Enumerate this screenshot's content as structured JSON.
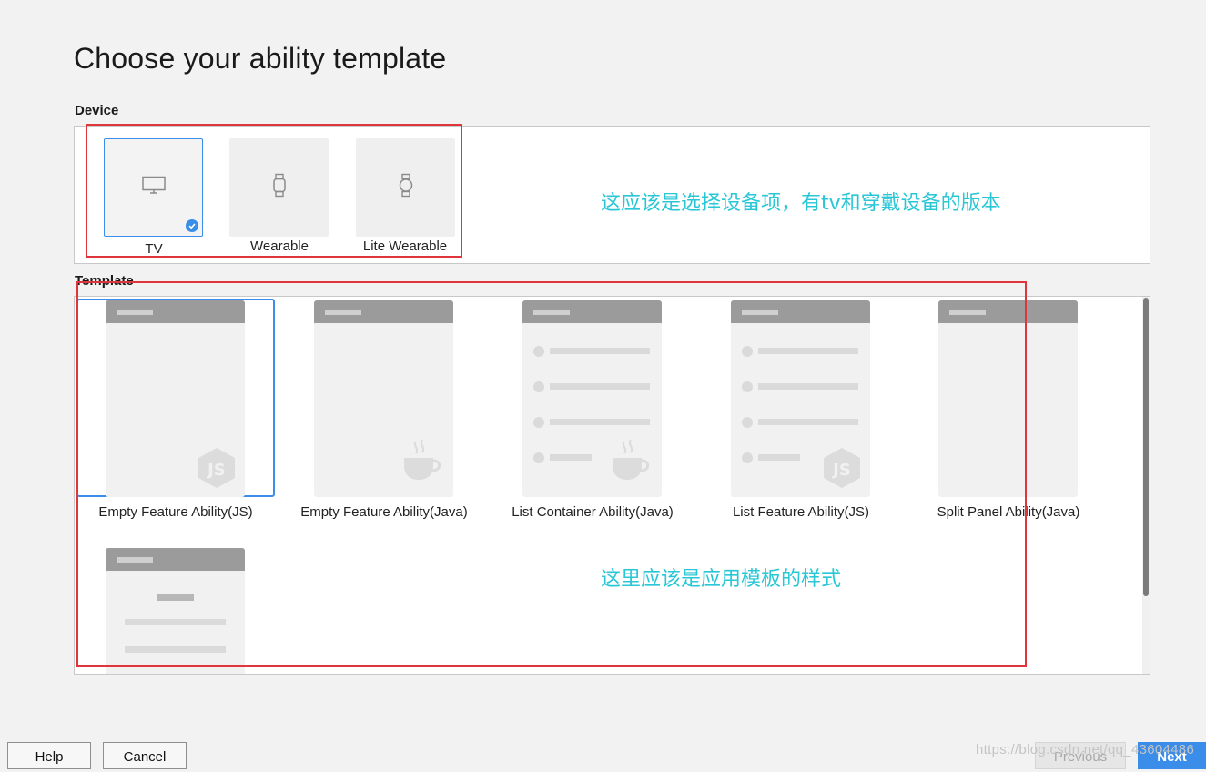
{
  "page": {
    "title": "Choose your ability template"
  },
  "device": {
    "label": "Device",
    "options": [
      {
        "name": "TV",
        "icon": "tv-icon",
        "selected": true
      },
      {
        "name": "Wearable",
        "icon": "wearable-watch-icon",
        "selected": false
      },
      {
        "name": "Lite Wearable",
        "icon": "lite-wearable-watch-icon",
        "selected": false
      }
    ]
  },
  "template": {
    "label": "Template",
    "options": [
      {
        "name": "Empty Feature Ability(JS)",
        "badge": "js-icon",
        "selected": true
      },
      {
        "name": "Empty Feature Ability(Java)",
        "badge": "java-cup-icon",
        "selected": false
      },
      {
        "name": "List Container Ability(Java)",
        "badge": "java-cup-icon",
        "selected": false
      },
      {
        "name": "List Feature Ability(JS)",
        "badge": "js-icon",
        "selected": false
      },
      {
        "name": "Split Panel Ability(Java)",
        "badge": "",
        "selected": false
      },
      {
        "name": "",
        "badge": "",
        "selected": false
      }
    ]
  },
  "annotations": {
    "device_note": "这应该是选择设备项，有tv和穿戴设备的版本",
    "template_note": "这里应该是应用模板的样式",
    "box_color": "#e0353b",
    "text_color": "#29c7d6"
  },
  "buttons": {
    "help": "Help",
    "cancel": "Cancel",
    "previous": "Previous",
    "next": "Next"
  },
  "watermark": "https://blog.csdn.net/qq_43604486",
  "colors": {
    "accent": "#3a8de8"
  }
}
